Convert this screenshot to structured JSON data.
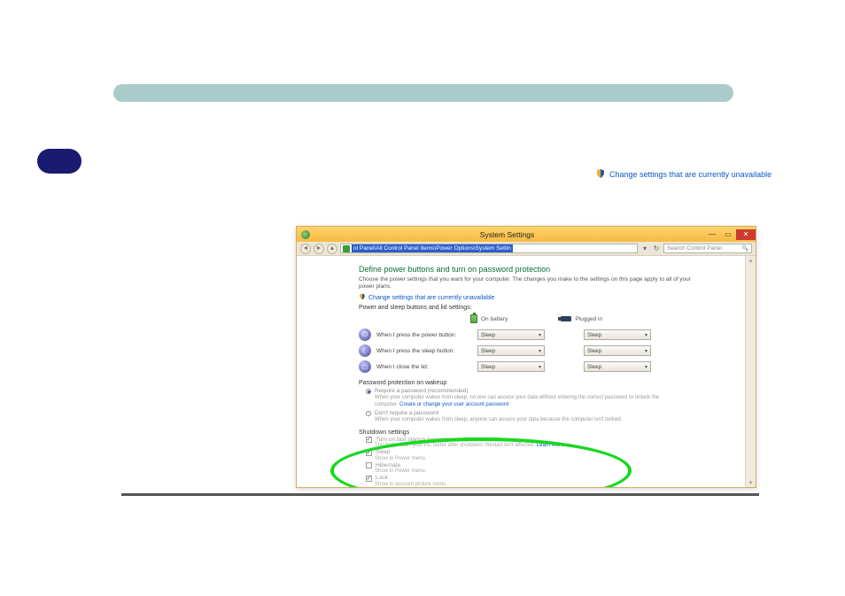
{
  "inline_link_text": "Change settings that are currently unavailable",
  "window": {
    "title": "System Settings",
    "address_label": "ol Panel\\All Control Panel Items\\Power Options\\System Settin",
    "search_placeholder": "Search Control Panel",
    "heading": "Define power buttons and turn on password protection",
    "description": "Choose the power settings that you want for your computer. The changes you make to the settings on this page apply to all of your power plans.",
    "change_link": "Change settings that are currently unavailable",
    "section_power_sleep": "Power and sleep buttons and lid settings:",
    "col_battery": "On battery",
    "col_plugged": "Plugged in",
    "rows": [
      {
        "label": "When I press the power button:",
        "battery": "Sleep",
        "plugged": "Sleep"
      },
      {
        "label": "When I press the sleep button:",
        "battery": "Sleep",
        "plugged": "Sleep"
      },
      {
        "label": "When I close the lid:",
        "battery": "Sleep",
        "plugged": "Sleep"
      }
    ],
    "section_password": "Password protection on wakeup",
    "radio_require_title": "Require a password (recommended)",
    "radio_require_desc_a": "When your computer wakes from sleep, no one can access your data without entering the correct password to unlock the computer. ",
    "radio_require_desc_link": "Create or change your user account password",
    "radio_dont_title": "Don't require a password",
    "radio_dont_desc": "When your computer wakes from sleep, anyone can access your data because the computer isn't locked.",
    "section_shutdown": "Shutdown settings",
    "chk_fast_title": "Turn on fast startup (recommended)",
    "chk_fast_desc_a": "This helps start your PC faster after shutdown. Restart isn't affected. ",
    "chk_fast_desc_link": "Learn More",
    "chk_sleep_title": "Sleep",
    "chk_sleep_desc": "Show in Power menu.",
    "chk_hibernate_title": "Hibernate",
    "chk_hibernate_desc": "Show in Power menu.",
    "chk_lock_title": "Lock",
    "chk_lock_desc": "Show in account picture menu."
  }
}
